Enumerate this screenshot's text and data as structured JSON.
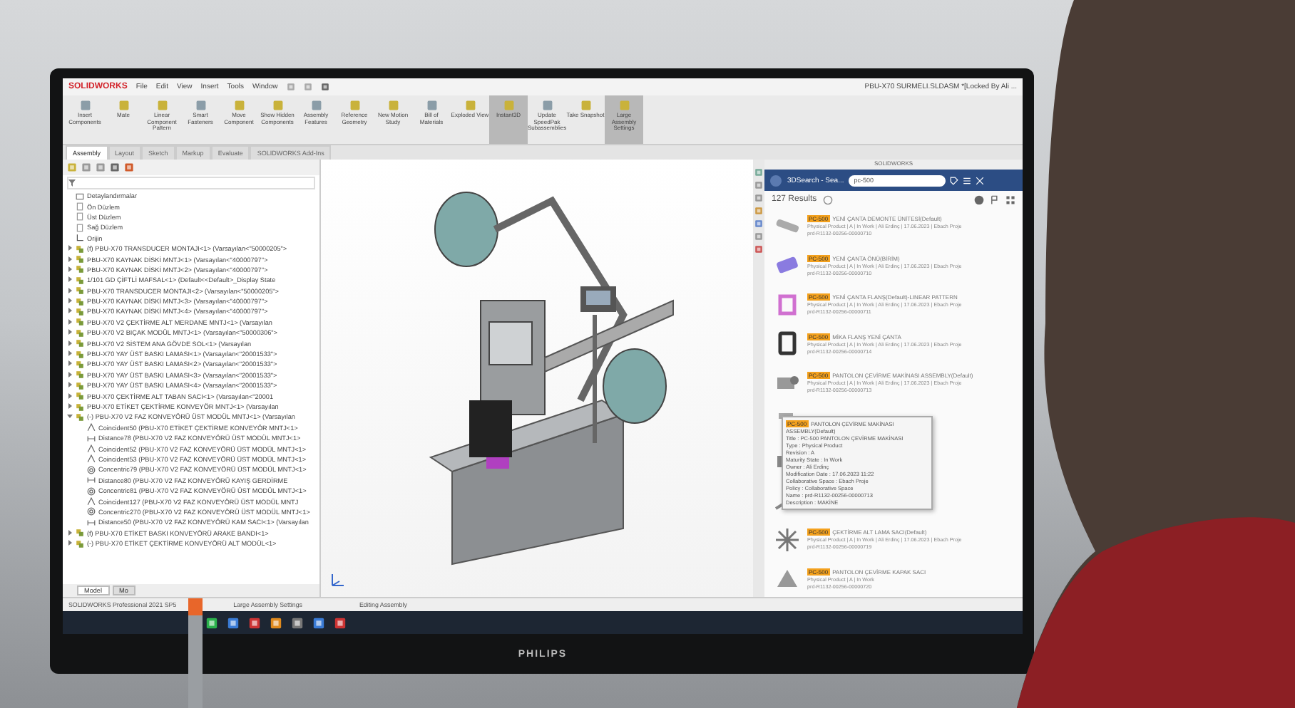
{
  "app": {
    "logo": "SOLIDWORKS",
    "menu": [
      "File",
      "Edit",
      "View",
      "Insert",
      "Tools",
      "Window"
    ],
    "document_title": "PBU-X70 SURMELI.SLDASM *[Locked By Ali ..."
  },
  "ribbon": [
    {
      "label": "Insert Components",
      "active": false
    },
    {
      "label": "Mate",
      "active": false
    },
    {
      "label": "Linear Component Pattern",
      "active": false
    },
    {
      "label": "Smart Fasteners",
      "active": false
    },
    {
      "label": "Move Component",
      "active": false
    },
    {
      "label": "Show Hidden Components",
      "active": false
    },
    {
      "label": "Assembly Features",
      "active": false
    },
    {
      "label": "Reference Geometry",
      "active": false
    },
    {
      "label": "New Motion Study",
      "active": false
    },
    {
      "label": "Bill of Materials",
      "active": false
    },
    {
      "label": "Exploded View",
      "active": false
    },
    {
      "label": "Instant3D",
      "active": true
    },
    {
      "label": "Update SpeedPak Subassemblies",
      "active": false
    },
    {
      "label": "Take Snapshot",
      "active": false
    },
    {
      "label": "Large Assembly Settings",
      "active": true
    }
  ],
  "tabs": [
    {
      "label": "Assembly",
      "selected": true
    },
    {
      "label": "Layout",
      "selected": false
    },
    {
      "label": "Sketch",
      "selected": false
    },
    {
      "label": "Markup",
      "selected": false
    },
    {
      "label": "Evaluate",
      "selected": false
    },
    {
      "label": "SOLIDWORKS Add-Ins",
      "selected": false
    }
  ],
  "tree": [
    {
      "kind": "folder",
      "label": "Detaylandırmalar"
    },
    {
      "kind": "plane",
      "label": "Ön Düzlem"
    },
    {
      "kind": "plane",
      "label": "Üst Düzlem"
    },
    {
      "kind": "plane",
      "label": "Sağ Düzlem"
    },
    {
      "kind": "origin",
      "label": "Orijin"
    },
    {
      "kind": "assembly",
      "expanded": false,
      "label": "(f) PBU-X70 TRANSDUCER MONTAJI<1> (Varsayılan<\"50000205\">"
    },
    {
      "kind": "assembly",
      "expanded": false,
      "label": "PBU-X70 KAYNAK DİSKİ MNTJ<1> (Varsayılan<\"40000797\">"
    },
    {
      "kind": "assembly",
      "expanded": false,
      "label": "PBU-X70 KAYNAK DİSKİ MNTJ<2> (Varsayılan<\"40000797\">"
    },
    {
      "kind": "assembly",
      "expanded": false,
      "label": "1/101 GD ÇİFTLİ MAFSAL<1> (Default<<Default>_Display State"
    },
    {
      "kind": "assembly",
      "expanded": false,
      "label": "PBU-X70 TRANSDUCER MONTAJI<2> (Varsayılan<\"50000205\">"
    },
    {
      "kind": "assembly",
      "expanded": false,
      "label": "PBU-X70 KAYNAK DİSKİ MNTJ<3> (Varsayılan<\"40000797\">"
    },
    {
      "kind": "assembly",
      "expanded": false,
      "label": "PBU-X70 KAYNAK DİSKİ MNTJ<4> (Varsayılan<\"40000797\">"
    },
    {
      "kind": "assembly",
      "expanded": false,
      "label": "PBU-X70 V2 ÇEKTİRME ALT MERDANE MNTJ<1> (Varsayılan"
    },
    {
      "kind": "assembly",
      "expanded": false,
      "label": "PBU-X70 V2 BIÇAK MODÜL MNTJ<1> (Varsayılan<\"50000306\">"
    },
    {
      "kind": "assembly",
      "expanded": false,
      "label": "PBU-X70 V2 SİSTEM ANA GÖVDE SOL<1> (Varsayılan"
    },
    {
      "kind": "assembly",
      "expanded": false,
      "label": "PBU-X70 YAY ÜST BASKI LAMASI<1> (Varsayılan<\"20001533\">"
    },
    {
      "kind": "assembly",
      "expanded": false,
      "label": "PBU-X70 YAY ÜST BASKI LAMASI<2> (Varsayılan<\"20001533\">"
    },
    {
      "kind": "assembly",
      "expanded": false,
      "label": "PBU-X70 YAY ÜST BASKI LAMASI<3> (Varsayılan<\"20001533\">"
    },
    {
      "kind": "assembly",
      "expanded": false,
      "label": "PBU-X70 YAY ÜST BASKI LAMASI<4> (Varsayılan<\"20001533\">"
    },
    {
      "kind": "assembly",
      "expanded": false,
      "label": "PBU-X70 ÇEKTİRME ALT TABAN SACI<1> (Varsayılan<\"20001"
    },
    {
      "kind": "assembly",
      "expanded": false,
      "label": "PBU-X70 ETİKET ÇEKTİRME KONVEYÖR MNTJ<1> (Varsayılan"
    },
    {
      "kind": "assembly",
      "expanded": true,
      "label": "(-) PBU-X70 V2 FAZ KONVEYÖRÜ ÜST MODÜL MNTJ<1> (Varsayılan",
      "children": [
        {
          "kind": "coincident",
          "label": "Coincident50 (PBU-X70 ETİKET ÇEKTİRME KONVEYÖR MNTJ<1>"
        },
        {
          "kind": "distance",
          "label": "Distance78 (PBU-X70 V2 FAZ KONVEYÖRÜ ÜST MODÜL MNTJ<1>"
        },
        {
          "kind": "coincident",
          "label": "Coincident52 (PBU-X70 V2 FAZ KONVEYÖRÜ ÜST MODÜL MNTJ<1>"
        },
        {
          "kind": "coincident",
          "label": "Coincident53 (PBU-X70 V2 FAZ KONVEYÖRÜ ÜST MODÜL MNTJ<1>"
        },
        {
          "kind": "concentric",
          "label": "Concentric79 (PBU-X70 V2 FAZ KONVEYÖRÜ ÜST MODÜL MNTJ<1>"
        },
        {
          "kind": "distance",
          "label": "Distance80 (PBU-X70 V2 FAZ KONVEYÖRÜ KAYIŞ GERDİRME"
        },
        {
          "kind": "concentric",
          "label": "Concentric81 (PBU-X70 V2 FAZ KONVEYÖRÜ ÜST MODÜL MNTJ<1>"
        },
        {
          "kind": "coincident",
          "label": "Coincident127 (PBU-X70 V2 FAZ KONVEYÖRÜ ÜST MODÜL MNTJ"
        },
        {
          "kind": "concentric",
          "label": "Concentric270 (PBU-X70 V2 FAZ KONVEYÖRÜ ÜST MODÜL MNTJ<1>"
        },
        {
          "kind": "distance",
          "label": "Distance50 (PBU-X70 V2 FAZ KONVEYÖRÜ KAM SACI<1> (Varsayılan"
        }
      ]
    },
    {
      "kind": "assembly",
      "expanded": false,
      "label": "(f) PBU-X70 ETİKET BASKI KONVEYÖRÜ ARAKE BANDI<1>"
    },
    {
      "kind": "assembly",
      "expanded": false,
      "label": "(-) PBU-X70 ETİKET ÇEKTİRME KONVEYÖRÜ ALT MODÜL<1>"
    }
  ],
  "tree_tabs": [
    {
      "label": "Model",
      "selected": true
    },
    {
      "label": "Mo",
      "selected": false
    }
  ],
  "search_panel": {
    "panel_title": "SOLIDWORKS",
    "app_name": "3DSearch - Sea...",
    "query": "pc-500",
    "results_count": "127  Results",
    "results": [
      {
        "kind": "roller",
        "tag": "PC-500",
        "title": "YENİ ÇANTA DEMONTE ÜNİTESİ(Default)",
        "details": "Physical Product | A | In Work | Ali Erdinç | 17.06.2023 | Ebach Proje",
        "id": "prd-R1132-00256-00000710"
      },
      {
        "kind": "block",
        "tag": "PC-500",
        "title": "YENİ ÇANTA ÖNÜ(BİRİM)",
        "details": "Physical Product | A | In Work | Ali Erdinç | 17.06.2023 | Ebach Proje",
        "id": "prd-R1132-00256-00000710"
      },
      {
        "kind": "frame",
        "tag": "PC-500",
        "title": "YENİ ÇANTA FLANŞ(Default)-LINEAR PATTERN",
        "details": "Physical Product | A | In Work | Ali Erdinç | 17.06.2023 | Ebach Proje",
        "id": "prd-R1132-00256-00000711"
      },
      {
        "kind": "flange",
        "tag": "PC-500",
        "title": "MİKA FLANŞ YENİ ÇANTA",
        "details": "Physical Product | A | In Work | Ali Erdinç | 17.06.2023 | Ebach Proje",
        "id": "prd-R1132-00256-00000714"
      },
      {
        "kind": "motor",
        "tag": "PC-500",
        "title": "PANTOLON ÇEVİRME MAKİNASI ASSEMBLY(Default)",
        "details": "Physical Product | A | In Work | Ali Erdinç | 17.06.2023 | Ebach Proje",
        "id": "prd-R1132-00256-00000713"
      },
      {
        "kind": "bracket"
      },
      {
        "kind": "box"
      },
      {
        "kind": "shaft"
      },
      {
        "kind": "star",
        "tag": "PC-500",
        "title": "ÇEKTİRME ALT LAMA SACI(Default)",
        "details": "Physical Product | A | In Work | Ali Erdinç | 17.06.2023 | Ebach Proje",
        "id": "prd-R1132-00256-00000719"
      },
      {
        "kind": "sheet",
        "tag": "PC-500",
        "title": "PANTOLON ÇEVİRME KAPAK SACI",
        "details": "Physical Product | A | In Work",
        "id": "prd-R1132-00256-00000720"
      }
    ],
    "tooltip": {
      "tag": "PC-500",
      "title": "PANTOLON ÇEVİRME MAKİNASI",
      "subtitle": "ASSEMBLY(Default)",
      "fields": [
        "Title : PC-500 PANTOLON ÇEVİRME MAKİNASI",
        "Type : Physical Product",
        "Revision : A",
        "Maturity State : In Work",
        "Owner : Ali Erdinç",
        "Modification Date : 17.06.2023 11:22",
        "Collaborative Space : Ebach Proje",
        "Policy : Collaborative Space",
        "Name : prd-R1132-00256-00000713",
        "Description : MAKİNE"
      ]
    }
  },
  "status_bar": {
    "product": "SOLIDWORKS Professional 2021 SP5",
    "items": [
      "Large Assembly Settings",
      "Editing Assembly"
    ]
  },
  "monitor_brand": "PHILIPS"
}
